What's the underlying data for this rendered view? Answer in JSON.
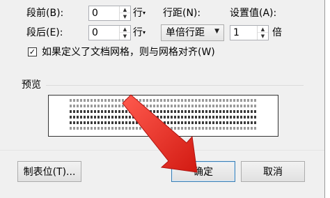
{
  "spacing": {
    "before_label": "段前(B):",
    "before_value": "0",
    "after_label": "段后(E):",
    "after_value": "0",
    "unit_before": "行",
    "unit_after": "行",
    "line_spacing_label": "行距(N):",
    "line_spacing_value": "单倍行距",
    "setting_label": "设置值(A):",
    "setting_value": "1",
    "setting_unit": "倍"
  },
  "grid_checkbox": {
    "label": "如果定义了文档网格，则与网格对齐(W)",
    "checked": true
  },
  "preview": {
    "title": "预览"
  },
  "buttons": {
    "tabs_label": "制表位(T)...",
    "ok_label": "确定",
    "cancel_label": "取消"
  },
  "colors": {
    "annotation_arrow": "#e02020",
    "dialog_bg": "#f0f0f0"
  }
}
